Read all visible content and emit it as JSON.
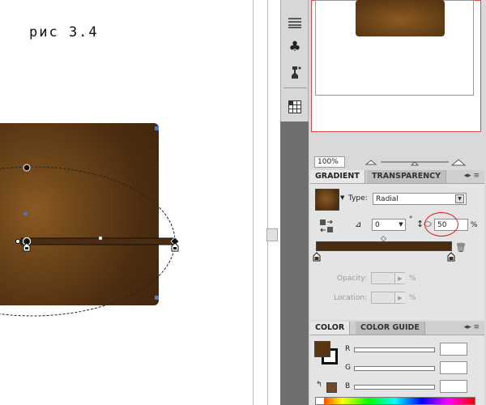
{
  "canvas": {
    "figure_label": "рис 3.4"
  },
  "tools": [
    {
      "icon": "lines-icon"
    },
    {
      "icon": "club-icon"
    },
    {
      "icon": "symbol-sprayer-icon"
    },
    {
      "icon": "grid-icon"
    }
  ],
  "navigator": {
    "zoom": "100%"
  },
  "gradient_panel": {
    "tabs": [
      {
        "label": "GRADIENT"
      },
      {
        "label": "TRANSPARENCY"
      }
    ],
    "type_label": "Type:",
    "type_value": "Radial",
    "angle_value": "0",
    "angle_unit": "°",
    "aspect_value": "50",
    "aspect_unit": "%",
    "opacity_label": "Opacity:",
    "opacity_unit": "%",
    "location_label": "Location:",
    "location_unit": "%",
    "stop_color": "#4b2c10",
    "highlight_color": "#d62020"
  },
  "color_panel": {
    "tabs": [
      {
        "label": "COLOR"
      },
      {
        "label": "COLOR GUIDE"
      }
    ],
    "channels": [
      {
        "label": "R"
      },
      {
        "label": "G"
      },
      {
        "label": "B"
      }
    ],
    "fill_color": "#5a3512"
  }
}
